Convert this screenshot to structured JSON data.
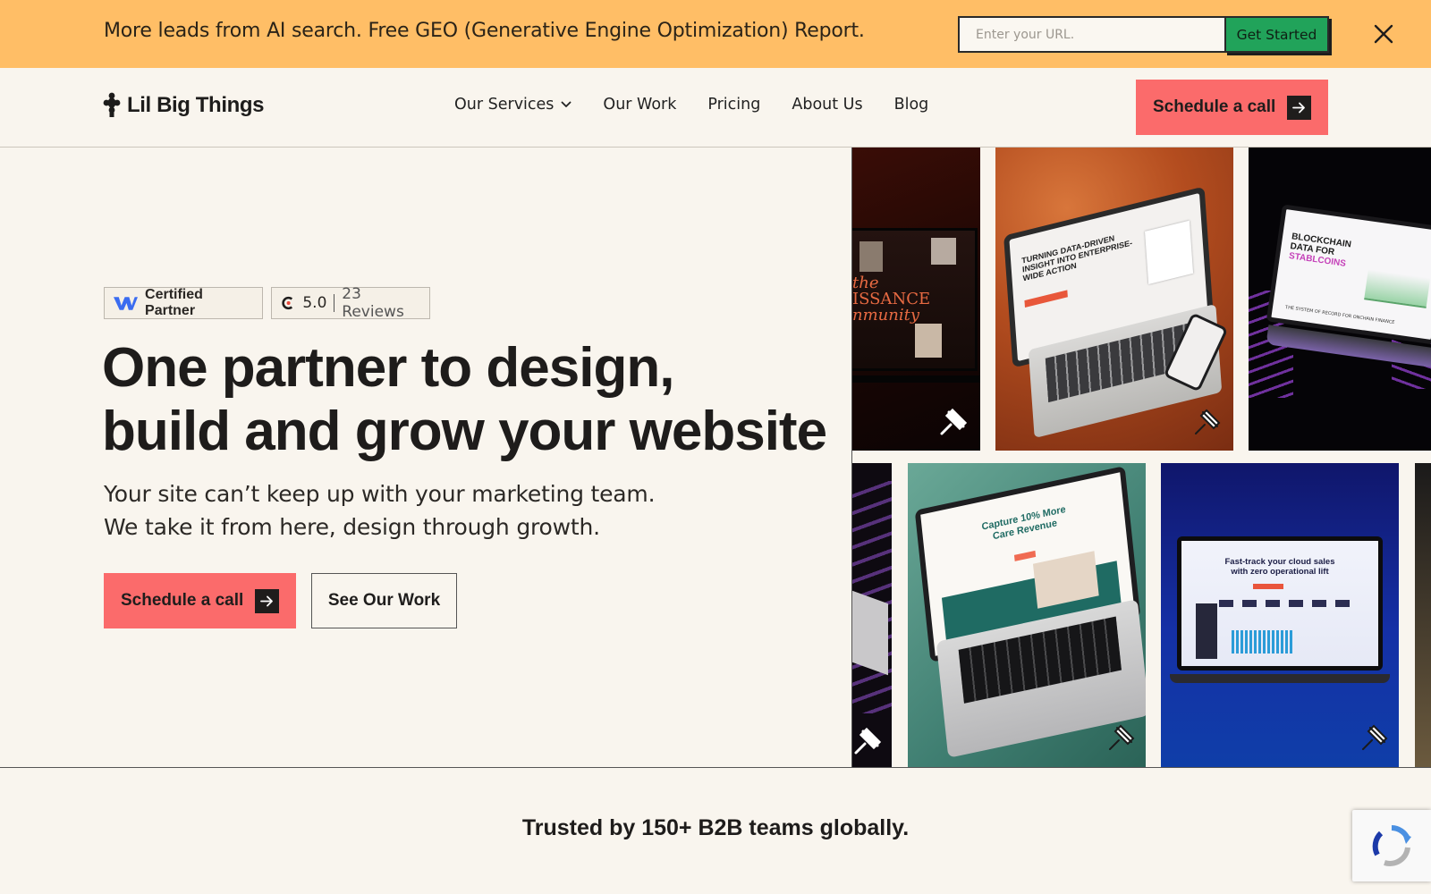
{
  "promo": {
    "text": "More leads from AI search. Free GEO (Generative Engine Optimization) Report.",
    "input_placeholder": "Enter your URL.",
    "submit_label": "Get Started",
    "close_icon": "close-icon"
  },
  "nav": {
    "logo_text": "Lil Big Things",
    "items": [
      "Our Services",
      "Our Work",
      "Pricing",
      "About Us",
      "Blog"
    ],
    "cta_label": "Schedule a call"
  },
  "hero": {
    "badge_partner": "Certified Partner",
    "badge_rating": "5.0",
    "badge_reviews": "23 Reviews",
    "title_line1": "One partner to design,",
    "title_line2": "build and grow your website",
    "sub_line1": "Your site can’t keep up with your marketing team.",
    "sub_line2": "We take it from here, design through growth.",
    "primary_cta": "Schedule a call",
    "secondary_cta": "See Our Work"
  },
  "gallery": {
    "tile1_text_line1": "the",
    "tile1_text_line2": "ISSANCE",
    "tile1_text_line3": "nmunity",
    "tile2_text": "TURNING DATA-DRIVEN INSIGHT INTO ENTERPRISE-WIDE ACTION",
    "tile3_text_line1": "BLOCKCHAIN",
    "tile3_text_line2": "DATA FOR",
    "tile3_text_line3": "STABLCOINS",
    "tile3_caption": "THE SYSTEM OF RECORD FOR ONCHAIN FINANCE",
    "tile5_text": "Capture 10% More Care Revenue",
    "tile6_text_line1": "Fast-track your cloud sales",
    "tile6_text_line2": "with zero operational lift"
  },
  "trusted": {
    "text": "Trusted by 150+ B2B teams globally."
  },
  "colors": {
    "banner": "#ffbe66",
    "accent": "#fb6b6b",
    "cta_green": "#21a35a",
    "background": "#f9f5ee"
  }
}
